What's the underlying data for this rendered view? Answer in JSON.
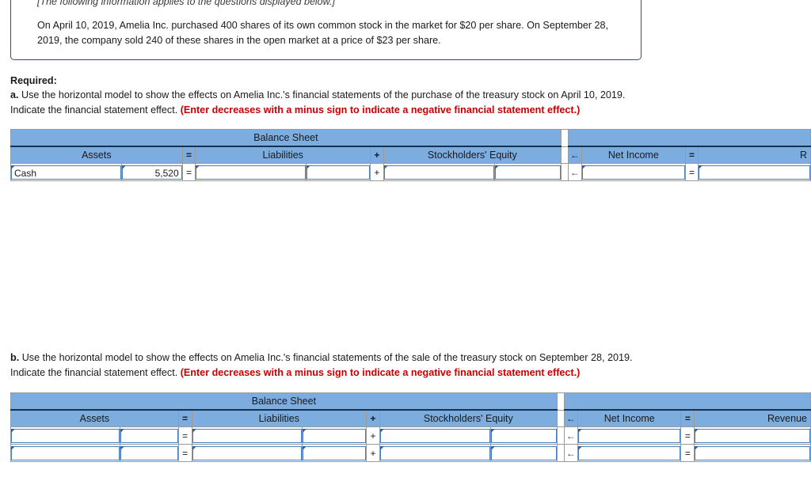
{
  "info": {
    "italic_note": "[The following information applies to the questions displayed below.]",
    "paragraph": "On April 10, 2019, Amelia Inc. purchased 400 shares of its own common stock in the market for $20 per share. On September 28, 2019, the company sold 240 of these shares in the open market at a price of $23 per share."
  },
  "required": {
    "title": "Required:",
    "part_a": {
      "letter": "a.",
      "text": " Use the horizontal model to show the effects on Amelia Inc.'s financial statements of the purchase of the treasury stock on April 10, 2019. Indicate the financial statement effect. ",
      "note": "(Enter decreases with a minus sign to indicate a negative financial statement effect.)"
    },
    "part_b": {
      "letter": "b.",
      "text": " Use the horizontal model to show the effects on Amelia Inc.'s financial statements of the sale of the treasury stock on September 28, 2019. Indicate the financial statement effect. ",
      "note": "(Enter decreases with a minus sign to indicate a negative financial statement effect.)"
    }
  },
  "headers": {
    "balance_sheet": "Balance Sheet",
    "assets": "Assets",
    "liabilities": "Liabilities",
    "stockholders_equity": "Stockholders' Equity",
    "net_income": "Net Income",
    "revenue_truncated": "R",
    "revenue": "Revenue",
    "op_equals": "=",
    "op_plus": "+",
    "op_arrow": "←"
  },
  "table_a": {
    "rows": [
      {
        "asset_label": "Cash",
        "asset_amount": "5,520",
        "liability_label": "",
        "liability_amount": "",
        "equity_label": "",
        "equity_amount": "",
        "net_income": "",
        "revenue": ""
      }
    ]
  },
  "table_b": {
    "rows": [
      {
        "asset_label": "",
        "asset_amount": "",
        "liability_label": "",
        "liability_amount": "",
        "equity_label": "",
        "equity_amount": "",
        "net_income": "",
        "revenue": ""
      },
      {
        "asset_label": "",
        "asset_amount": "",
        "liability_label": "",
        "liability_amount": "",
        "equity_label": "",
        "equity_amount": "",
        "net_income": "",
        "revenue": ""
      }
    ]
  },
  "colors": {
    "header_blue": "#7cadde",
    "input_border": "#4a7ebb",
    "box_border": "#2f4f82",
    "note_red": "#cc0000"
  }
}
